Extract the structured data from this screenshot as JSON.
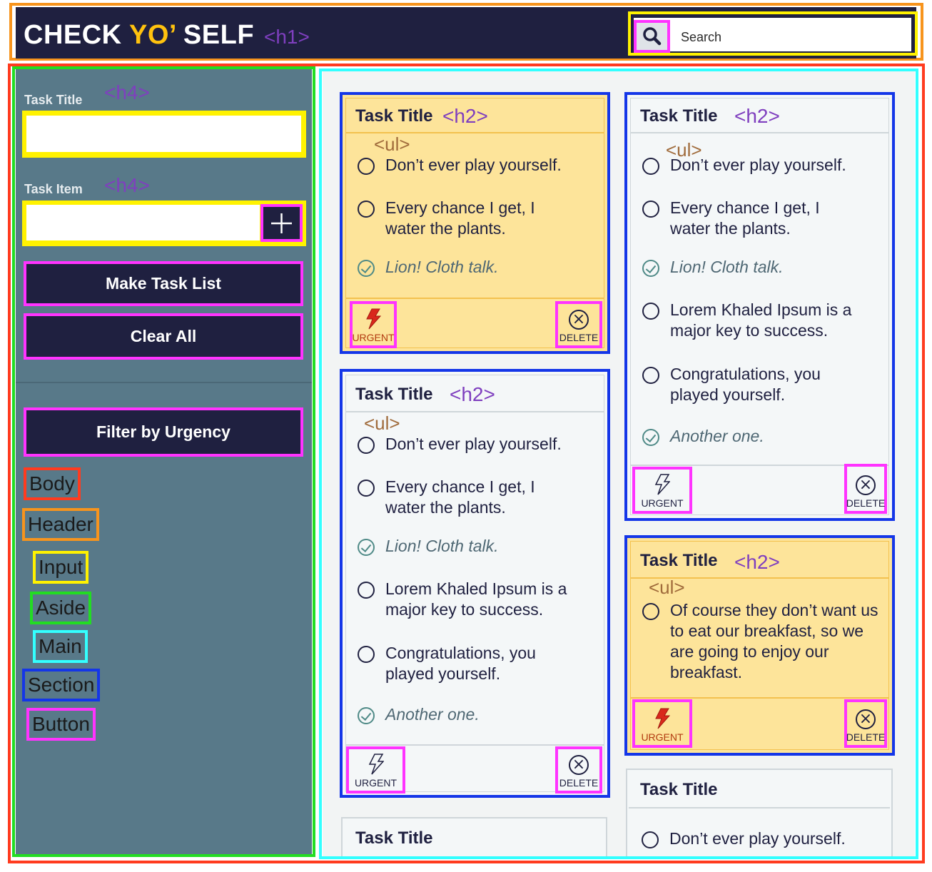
{
  "header": {
    "title_main": "CHECK ",
    "title_accent": "YO’",
    "title_end": " SELF",
    "h1_tag": "<h1>",
    "search_placeholder": "Search",
    "search_icon": "search-icon"
  },
  "aside": {
    "task_title_label": "Task Title",
    "task_item_label": "Task Item",
    "h4_tag": "<h4>",
    "add_icon": "plus-icon",
    "make_list_label": "Make Task List",
    "clear_all_label": "Clear All",
    "filter_label": "Filter by Urgency"
  },
  "legend": [
    {
      "label": "Body",
      "color": "#ff3b1f"
    },
    {
      "label": "Header",
      "color": "#f7941d"
    },
    {
      "label": "Input",
      "color": "#fff200"
    },
    {
      "label": "Aside",
      "color": "#22dd22"
    },
    {
      "label": "Main",
      "color": "#33ffff"
    },
    {
      "label": "Section",
      "color": "#1436e8"
    },
    {
      "label": "Button",
      "color": "#ff33ff"
    }
  ],
  "tags": {
    "h2": "<h2>",
    "ul": "<ul>"
  },
  "buttons": {
    "urgent": "URGENT",
    "delete": "DELETE"
  },
  "colors": {
    "urgent_bg": "#fde49a",
    "normal_bg": "#f4f7f8",
    "urgent_active": "#d9281c",
    "urgent_text_active": "#b23a10"
  },
  "cards": [
    {
      "title": "Task Title",
      "urgent": true,
      "items": [
        {
          "text": "Don’t ever play yourself.",
          "done": false
        },
        {
          "text": "Every chance I get, I water the plants.",
          "done": false
        },
        {
          "text": "Lion! Cloth talk.",
          "done": true
        }
      ]
    },
    {
      "title": "Task Title",
      "urgent": false,
      "items": [
        {
          "text": "Don’t ever play yourself.",
          "done": false
        },
        {
          "text": "Every chance I get, I water the plants.",
          "done": false
        },
        {
          "text": "Lion! Cloth talk.",
          "done": true
        },
        {
          "text": "Lorem Khaled Ipsum is a major key to success.",
          "done": false
        },
        {
          "text": "Congratulations, you played yourself.",
          "done": false
        },
        {
          "text": "Another one.",
          "done": true
        }
      ]
    },
    {
      "title": "Task Title",
      "urgent": false,
      "items": [
        {
          "text": "Don’t ever play yourself.",
          "done": false
        },
        {
          "text": "Every chance I get, I water the plants.",
          "done": false
        },
        {
          "text": "Lion! Cloth talk.",
          "done": true
        },
        {
          "text": "Lorem Khaled Ipsum is a major key to success.",
          "done": false
        },
        {
          "text": "Congratulations, you played yourself.",
          "done": false
        },
        {
          "text": "Another one.",
          "done": true
        }
      ]
    },
    {
      "title": "Task Title",
      "urgent": true,
      "items": [
        {
          "text": "Of course they don’t want us to eat our breakfast, so we are going to enjoy our breakfast.",
          "done": false
        }
      ]
    },
    {
      "title": "Task Title",
      "items": []
    },
    {
      "title": "Task Title",
      "items": [
        {
          "text": "Don’t ever play yourself.",
          "done": false
        }
      ]
    }
  ]
}
